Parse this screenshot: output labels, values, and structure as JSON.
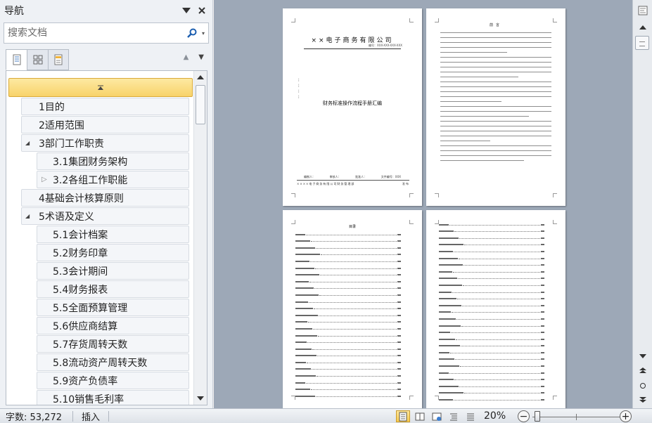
{
  "nav": {
    "title": "导航",
    "search_placeholder": "搜索文档",
    "tree": [
      {
        "label": "1目的",
        "level": 1
      },
      {
        "label": "2适用范围",
        "level": 1
      },
      {
        "label": "3部门工作职责",
        "level": 1,
        "expanded": true
      },
      {
        "label": "3.1集团财务架构",
        "level": 2
      },
      {
        "label": "3.2各组工作职能",
        "level": 2,
        "collapsed": true
      },
      {
        "label": "4基础会计核算原则",
        "level": 1
      },
      {
        "label": "5术语及定义",
        "level": 1,
        "expanded": true
      },
      {
        "label": "5.1会计档案",
        "level": 2
      },
      {
        "label": "5.2财务印章",
        "level": 2
      },
      {
        "label": "5.3会计期间",
        "level": 2
      },
      {
        "label": "5.4财务报表",
        "level": 2
      },
      {
        "label": "5.5全面预算管理",
        "level": 2
      },
      {
        "label": "5.6供应商结算",
        "level": 2
      },
      {
        "label": "5.7存货周转天数",
        "level": 2
      },
      {
        "label": "5.8流动资产周转天数",
        "level": 2
      },
      {
        "label": "5.9资产负债率",
        "level": 2
      },
      {
        "label": "5.10销售毛利率",
        "level": 2
      }
    ]
  },
  "pages": {
    "cover": {
      "company": "××电子商务有限公司",
      "code": "编号：XXX-XXX-XXX-XXX",
      "title": "财务标准操作流程手册汇编",
      "sign": [
        "编制人：",
        "审核人：",
        "批准人：",
        "文件编号：XXX"
      ],
      "footer_left": "××××电子商务有限公司财务管理部",
      "footer_right": "发布"
    },
    "preface": {
      "title": "前言"
    },
    "toc": {
      "title": "目录"
    }
  },
  "status": {
    "words": "字数: 53,272",
    "mode": "插入",
    "zoom": "20%",
    "zoom_out": "−",
    "zoom_in": "+",
    "zoom_percent": 20
  }
}
